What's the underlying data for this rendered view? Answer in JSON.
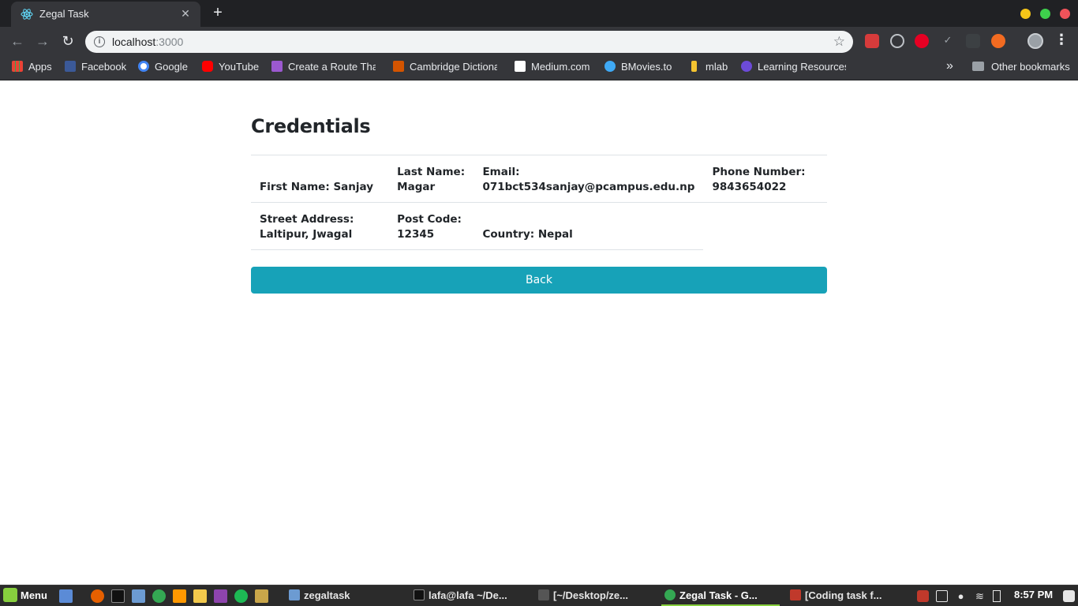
{
  "browser": {
    "tab_title": "Zegal Task",
    "tab_close": "✕",
    "new_tab": "+",
    "url_host": "localhost",
    "url_port": ":3000",
    "bookmarks": [
      {
        "label": "Apps",
        "icon": "apps-grid-icon",
        "color": "#4285f4"
      },
      {
        "label": "Facebook",
        "icon": "facebook-icon",
        "color": "#3b5998"
      },
      {
        "label": "Google",
        "icon": "google-icon",
        "color": "#ffffff"
      },
      {
        "label": "YouTube",
        "icon": "youtube-icon",
        "color": "#ff0000"
      },
      {
        "label": "Create a Route That",
        "icon": "cloud-icon",
        "color": "#9b59d0"
      },
      {
        "label": "Cambridge Dictiona",
        "icon": "cambridge-icon",
        "color": "#d35400"
      },
      {
        "label": "Medium.com",
        "icon": "medium-icon",
        "color": "#ffffff"
      },
      {
        "label": "BMovies.to",
        "icon": "play-icon",
        "color": "#3fa9f5"
      },
      {
        "label": "mlab",
        "icon": "mlab-icon",
        "color": "#f4c430"
      },
      {
        "label": "Learning Resources",
        "icon": "learning-icon",
        "color": "#6c4bd8"
      }
    ],
    "overflow": "»",
    "other_bookmarks": "Other bookmarks"
  },
  "page": {
    "heading": "Credentials",
    "rows": [
      [
        {
          "label": "First Name: ",
          "value": "Sanjay"
        },
        {
          "label": "Last Name: ",
          "value": "Magar"
        },
        {
          "label": "Email: ",
          "value": "071bct534sanjay@pcampus.edu.np"
        },
        {
          "label": "Phone Number: ",
          "value": "9843654022"
        }
      ],
      [
        {
          "label": "Street Address: ",
          "value": "Laltipur, Jwagal"
        },
        {
          "label": "Post Code: ",
          "value": "12345"
        },
        {
          "label": "Country: ",
          "value": "Nepal"
        }
      ]
    ],
    "back_button": "Back",
    "button_color": "#17a2b8"
  },
  "taskbar": {
    "menu": "Menu",
    "tasks": [
      {
        "label": "zegaltask",
        "icon": "folder-icon"
      },
      {
        "label": "lafa@lafa ~/De...",
        "icon": "terminal-icon"
      },
      {
        "label": "[~/Desktop/ze...",
        "icon": "sublime-icon"
      },
      {
        "label": "Zegal Task - G...",
        "icon": "chrome-icon"
      },
      {
        "label": "[Coding task f...",
        "icon": "document-icon"
      }
    ],
    "clock": "8:57 PM"
  }
}
